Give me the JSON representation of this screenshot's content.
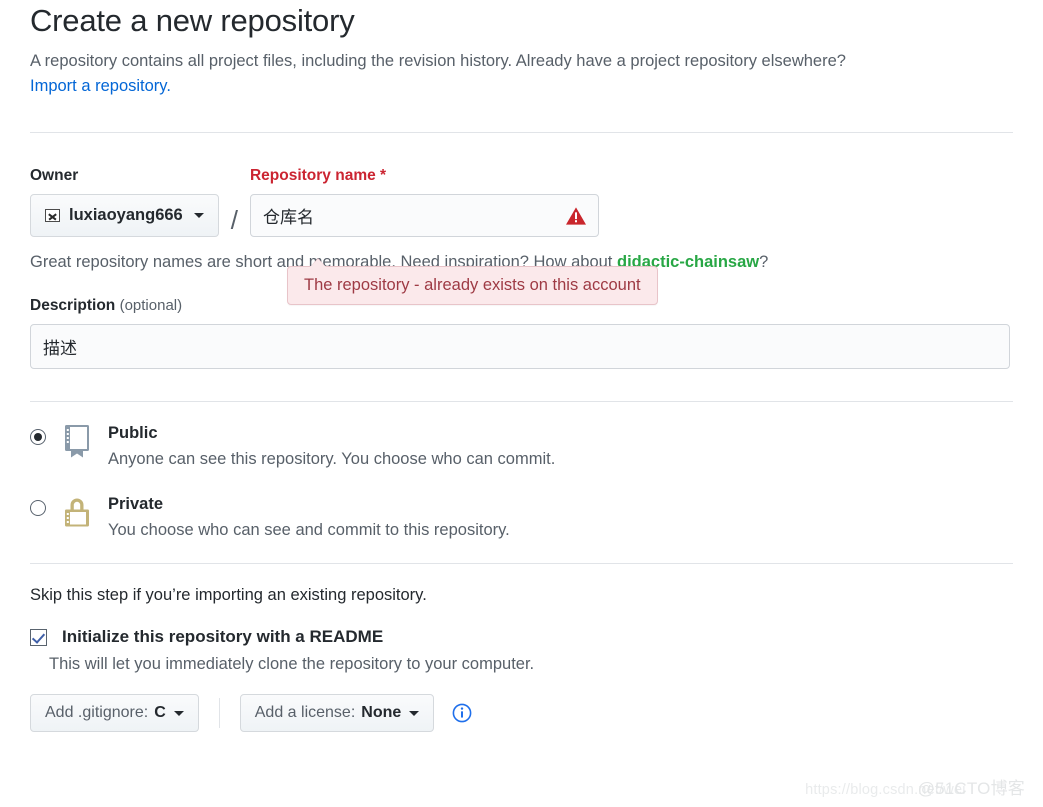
{
  "header": {
    "title": "Create a new repository",
    "subtitle": "A repository contains all project files, including the revision history. Already have a project repository elsewhere?",
    "import_link": "Import a repository."
  },
  "owner": {
    "label": "Owner",
    "name": "luxiaoyang666",
    "avatar_icon": "broken-image-icon",
    "caret_icon": "chevron-down-icon"
  },
  "separator": "/",
  "repo_name": {
    "label": "Repository name",
    "required_mark": "*",
    "value": "仓库名",
    "placeholder": "",
    "warning_icon": "alert-triangle-icon"
  },
  "tooltip": {
    "message": "The repository - already exists on this account",
    "bg_color": "#fbe9eb",
    "text_color": "#9e3a44",
    "border_color": "#e8c4c9"
  },
  "helper": {
    "text_before": "Great repository names are short and memorable. Need inspiration? How about",
    "suggestion": "didactic-chainsaw",
    "text_after": "?",
    "suggestion_color": "#28a745"
  },
  "description": {
    "label": "Description",
    "optional_label": "(optional)",
    "value": "描述",
    "placeholder": ""
  },
  "visibility": {
    "options": [
      {
        "id": "public",
        "title": "Public",
        "description": "Anyone can see this repository. You choose who can commit.",
        "selected": true,
        "icon": "repo-book-icon",
        "icon_color": "#8a9aa9"
      },
      {
        "id": "private",
        "title": "Private",
        "description": "You choose who can see and commit to this repository.",
        "selected": false,
        "icon": "lock-icon",
        "icon_color": "#c3b378"
      }
    ]
  },
  "initialize": {
    "note": "Skip this step if you’re importing an existing repository.",
    "checkbox_label": "Initialize this repository with a README",
    "checkbox_description": "This will let you immediately clone the repository to your computer.",
    "checked": true
  },
  "bottom_controls": {
    "gitignore": {
      "prefix": "Add .gitignore:",
      "value": "C",
      "caret_icon": "chevron-down-icon"
    },
    "license": {
      "prefix": "Add a license:",
      "value": "None",
      "caret_icon": "chevron-down-icon"
    },
    "info_icon": "info-circle-icon",
    "info_icon_color": "#0366d6"
  },
  "watermark": {
    "url": "https://blog.csdn.net/wei",
    "brand": "@51CTO博客"
  }
}
